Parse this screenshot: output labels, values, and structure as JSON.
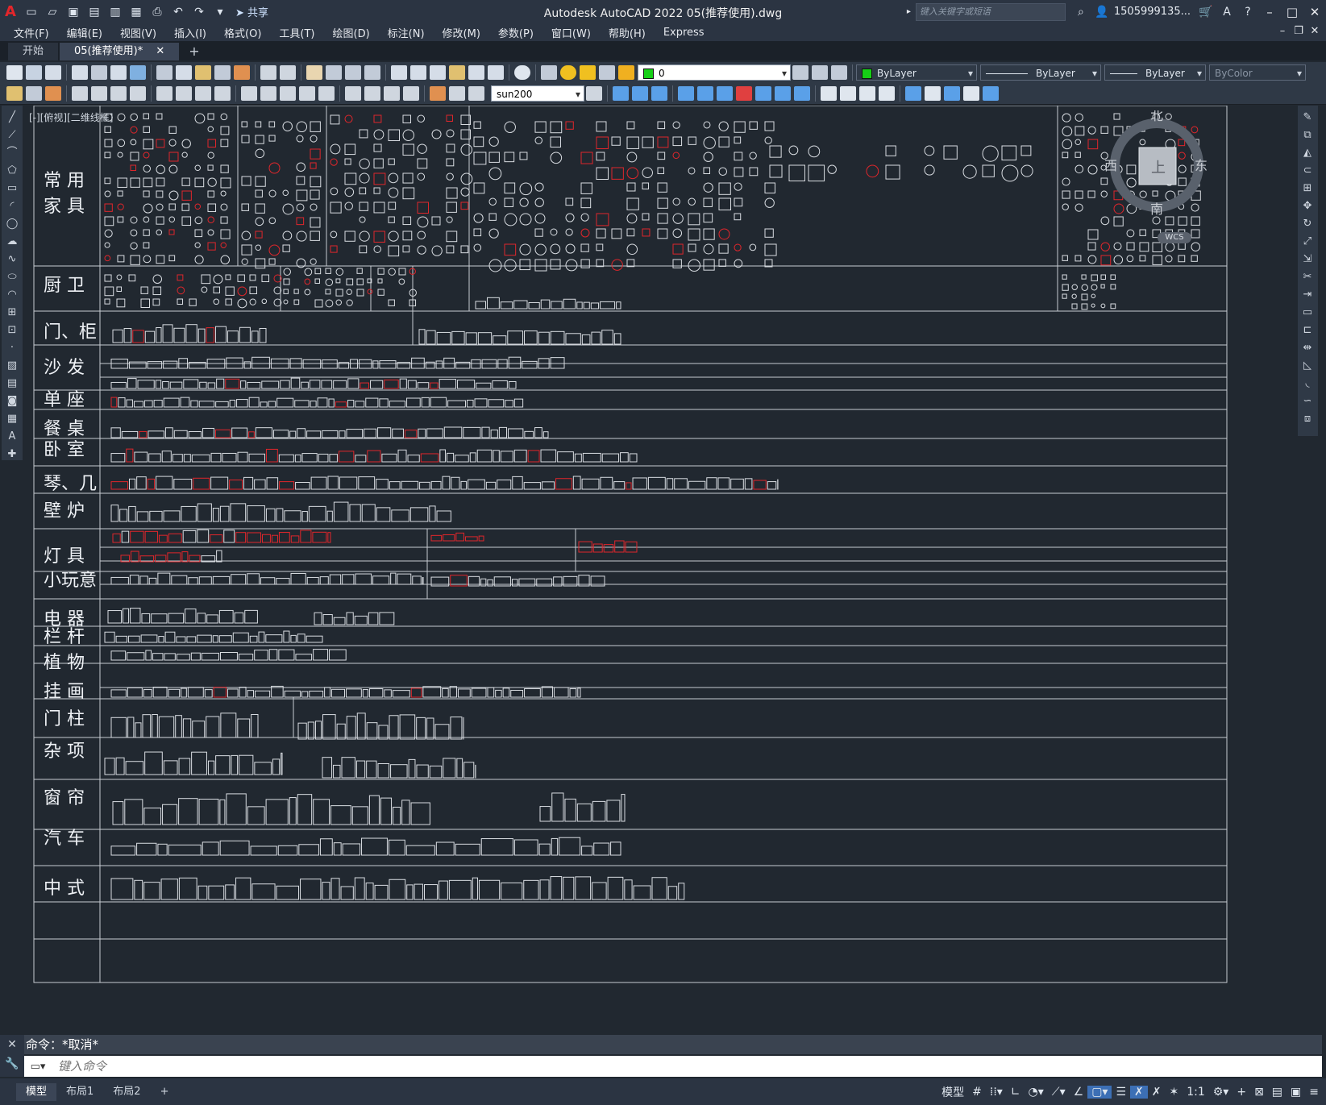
{
  "titlebar": {
    "app_logo": "A",
    "share_label": "共享",
    "window_title": "Autodesk AutoCAD 2022    05(推荐使用).dwg",
    "search_placeholder": "键入关键字或短语",
    "user_name": "1505999135...",
    "window_buttons": [
      "–",
      "□",
      "✕"
    ]
  },
  "menu": {
    "items": [
      "文件(F)",
      "编辑(E)",
      "视图(V)",
      "插入(I)",
      "格式(O)",
      "工具(T)",
      "绘图(D)",
      "标注(N)",
      "修改(M)",
      "参数(P)",
      "窗口(W)",
      "帮助(H)",
      "Express"
    ]
  },
  "tabs": {
    "start_label": "开始",
    "active_label": "05(推荐使用)*",
    "close_symbol": "✕",
    "add_symbol": "+"
  },
  "toolbar": {
    "layer_value": "0",
    "color_value": "ByLayer",
    "color_swatch": "#16d016",
    "linetype_value": "ByLayer",
    "lineweight_value": "ByLayer",
    "plotstyle_value": "ByColor",
    "textstyle_value": "sun200"
  },
  "viewport_label": "[-][俯视][二维线框]",
  "viewcube": {
    "north": "北",
    "south": "南",
    "east": "东",
    "west": "西",
    "top_face": "上",
    "wcs": "WCS"
  },
  "categories": [
    {
      "label": "常  用"
    },
    {
      "label": "家  具"
    },
    {
      "label": "厨  卫"
    },
    {
      "label": "门、柜"
    },
    {
      "label": "沙  发"
    },
    {
      "label": "单  座"
    },
    {
      "label": "餐  桌"
    },
    {
      "label": "卧  室"
    },
    {
      "label": "琴、几"
    },
    {
      "label": "壁  炉"
    },
    {
      "label": "灯  具"
    },
    {
      "label": "小玩意"
    },
    {
      "label": "电  器"
    },
    {
      "label": "栏  杆"
    },
    {
      "label": "植  物"
    },
    {
      "label": "挂  画"
    },
    {
      "label": "门  柱"
    },
    {
      "label": "杂  项"
    },
    {
      "label": "窗  帘"
    },
    {
      "label": "汽  车"
    },
    {
      "label": "中  式"
    }
  ],
  "command": {
    "history": "命令：*取消*",
    "placeholder": "键入命令"
  },
  "statusbar": {
    "layouts": [
      "模型",
      "布局1",
      "布局2"
    ],
    "add_layout": "+",
    "model_label": "模型",
    "scale_label": "1:1"
  }
}
